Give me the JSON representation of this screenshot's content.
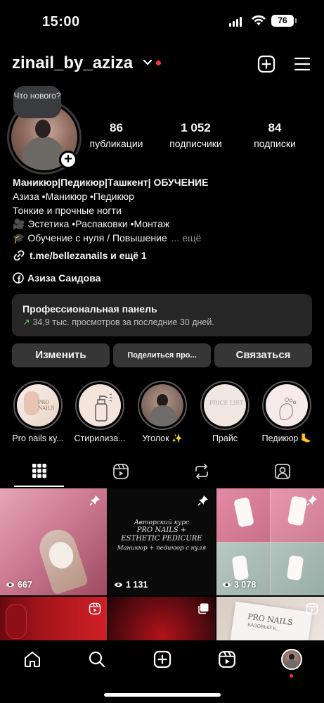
{
  "status_bar": {
    "time": "15:00",
    "battery": "76"
  },
  "header": {
    "username": "zinail_by_aziza"
  },
  "note": {
    "text": "Что нового?"
  },
  "stats": [
    {
      "value": "86",
      "label": "публикации"
    },
    {
      "value": "1 052",
      "label": "подписчики"
    },
    {
      "value": "84",
      "label": "подписки"
    }
  ],
  "bio": {
    "name": "Маникюр|Педикюр|Ташкент| ОБУЧЕНИЕ",
    "line1": "Азиза •Маникюр •Педикюр",
    "line2": "Тонкие и прочные ногти",
    "line3": "🎥 Эстетика •Распаковки •Монтаж",
    "line4": "🎓 Обучение с нуля / Повышение",
    "more": "... ещё",
    "link": "t.me/bellezanails и ещё 1",
    "facebook": "Азиза Саидова"
  },
  "pro_panel": {
    "title": "Профессиональная панель",
    "subtitle": "34,9 тыс. просмотров за последние 30 дней."
  },
  "buttons": {
    "edit": "Изменить",
    "share": "Поделиться про...",
    "contact": "Связаться"
  },
  "highlights": [
    {
      "label": "Pro nails ку..."
    },
    {
      "label": "Стирилиза..."
    },
    {
      "label": "Уголок ✨"
    },
    {
      "label": "Прайс"
    },
    {
      "label": "Педикюр 🦶"
    }
  ],
  "grid": [
    {
      "views": "667",
      "pinned": true
    },
    {
      "views": "1 131",
      "pinned": true,
      "caption_top": "Авторский курс",
      "caption_title": "PRO NAILS + ESTHETIC PEDICURE",
      "caption_sub": "Маникюр + педикюр с нуля"
    },
    {
      "views": "3 078",
      "pinned": true
    },
    {
      "type": "reel"
    },
    {
      "type": "carousel"
    },
    {
      "type": "reel",
      "text": "PRO NAILS",
      "subtext": "БАЗОВЫЙ К..."
    }
  ],
  "highlight_texts": {
    "pro_nails": "PRO NAILS",
    "price": "PRICE LIST"
  },
  "colors": {
    "background": "#000000",
    "button": "#363636",
    "panel": "#262626",
    "accent_red": "#ff3040",
    "trend_green": "#5ec26a"
  }
}
